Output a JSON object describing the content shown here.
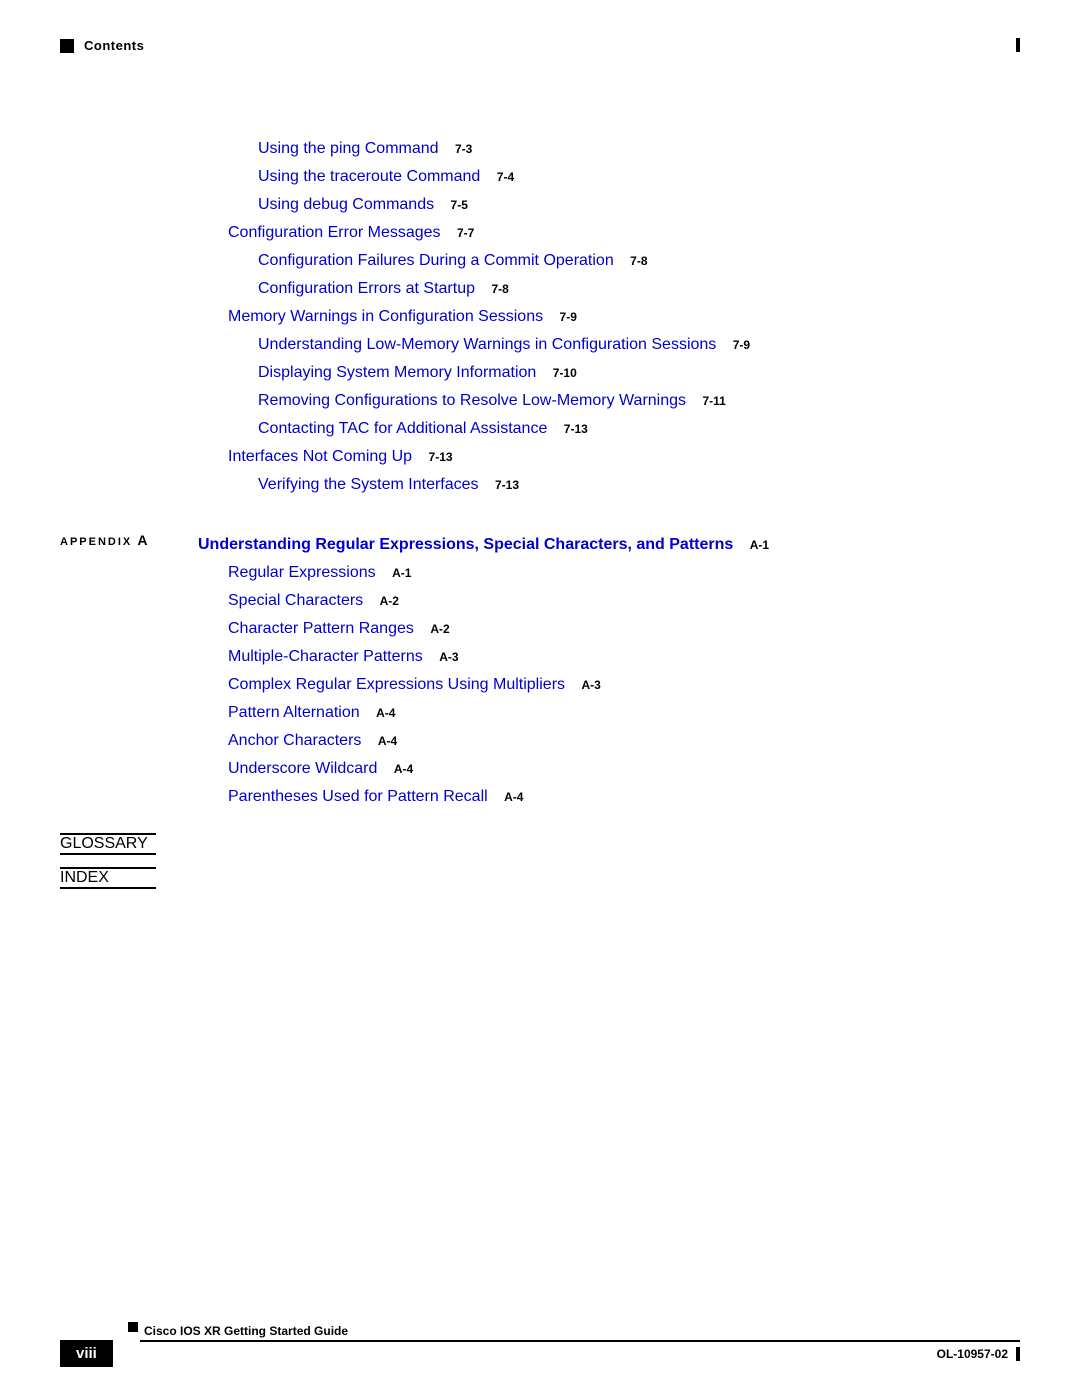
{
  "header": {
    "title": "Contents"
  },
  "toc": {
    "group1": [
      {
        "title": "Using the ping Command",
        "page": "7-3",
        "indent": 1
      },
      {
        "title": "Using the traceroute Command",
        "page": "7-4",
        "indent": 1
      },
      {
        "title": "Using debug Commands",
        "page": "7-5",
        "indent": 1
      }
    ],
    "group2_head": {
      "title": "Configuration Error Messages",
      "page": "7-7"
    },
    "group2": [
      {
        "title": "Configuration Failures During a Commit Operation",
        "page": "7-8"
      },
      {
        "title": "Configuration Errors at Startup",
        "page": "7-8"
      }
    ],
    "group3_head": {
      "title": "Memory Warnings in Configuration Sessions",
      "page": "7-9"
    },
    "group3": [
      {
        "title": "Understanding Low-Memory Warnings in Configuration Sessions",
        "page": "7-9"
      },
      {
        "title": "Displaying System Memory Information",
        "page": "7-10"
      },
      {
        "title": "Removing Configurations to Resolve Low-Memory Warnings",
        "page": "7-11"
      },
      {
        "title": "Contacting TAC for Additional Assistance",
        "page": "7-13"
      }
    ],
    "group4_head": {
      "title": "Interfaces Not Coming Up",
      "page": "7-13"
    },
    "group4": [
      {
        "title": "Verifying the System Interfaces",
        "page": "7-13"
      }
    ]
  },
  "appendix": {
    "label_prefix": "APPENDIX",
    "label_letter": "A",
    "title": "Understanding Regular Expressions, Special Characters, and Patterns",
    "title_page": "A-1",
    "items": [
      {
        "title": "Regular Expressions",
        "page": "A-1"
      },
      {
        "title": "Special Characters",
        "page": "A-2"
      },
      {
        "title": "Character Pattern Ranges",
        "page": "A-2"
      },
      {
        "title": "Multiple-Character Patterns",
        "page": "A-3"
      },
      {
        "title": "Complex Regular Expressions Using Multipliers",
        "page": "A-3"
      },
      {
        "title": "Pattern Alternation",
        "page": "A-4"
      },
      {
        "title": "Anchor Characters",
        "page": "A-4"
      },
      {
        "title": "Underscore Wildcard",
        "page": "A-4"
      },
      {
        "title": "Parentheses Used for Pattern Recall",
        "page": "A-4"
      }
    ]
  },
  "end_labels": {
    "glossary": "GLOSSARY",
    "index": "INDEX"
  },
  "footer": {
    "guide": "Cisco IOS XR Getting Started Guide",
    "page_num": "viii",
    "doc_id": "OL-10957-02"
  }
}
